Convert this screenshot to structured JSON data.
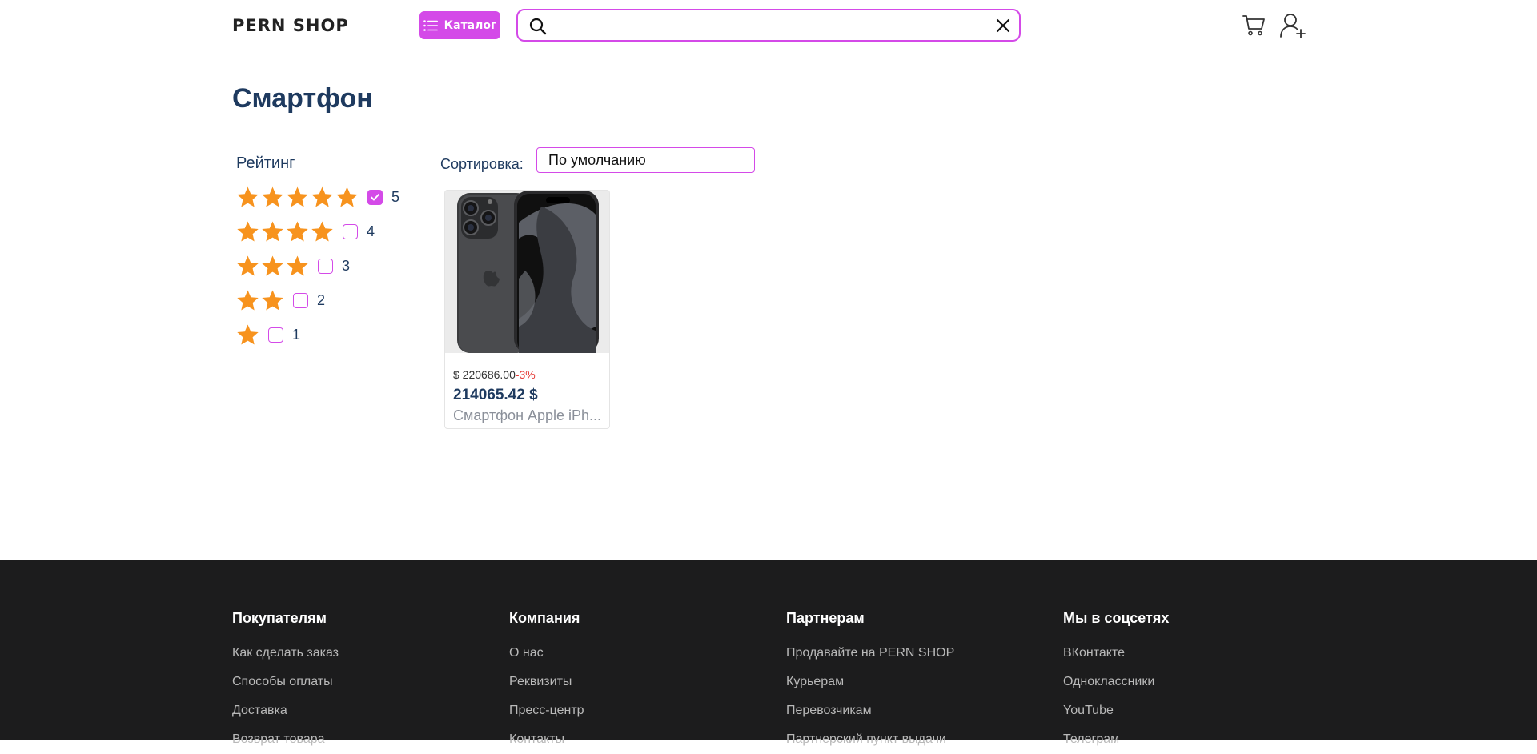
{
  "header": {
    "logo": "PERN SHOP",
    "catalog_label": "Каталог",
    "search_value": "",
    "search_placeholder": ""
  },
  "page_title": "Смартфон",
  "filters": {
    "rating_title": "Рейтинг",
    "rows": [
      {
        "stars": 5,
        "label": "5",
        "checked": true
      },
      {
        "stars": 4,
        "label": "4",
        "checked": false
      },
      {
        "stars": 3,
        "label": "3",
        "checked": false
      },
      {
        "stars": 2,
        "label": "2",
        "checked": false
      },
      {
        "stars": 1,
        "label": "1",
        "checked": false
      }
    ]
  },
  "sort": {
    "label": "Сортировка:",
    "value": "По умолчанию"
  },
  "products": [
    {
      "old_price": "$ 220686.00",
      "discount": "-3%",
      "price": "214065.42 $",
      "name": "Смартфон Apple iPh..."
    }
  ],
  "footer": {
    "columns": [
      {
        "title": "Покупателям",
        "links": [
          "Как сделать заказ",
          "Способы оплаты",
          "Доставка",
          "Возврат товара"
        ]
      },
      {
        "title": "Компания",
        "links": [
          "О нас",
          "Реквизиты",
          "Пресс-центр",
          "Контакты"
        ]
      },
      {
        "title": "Партнерам",
        "links": [
          "Продавайте на PERN SHOP",
          "Курьерам",
          "Перевозчикам",
          "Партнерский пункт выдачи"
        ]
      },
      {
        "title": "Мы в соцсетях",
        "links": [
          "ВКонтакте",
          "Одноклассники",
          "YouTube",
          "Телеграм"
        ]
      }
    ]
  },
  "colors": {
    "accent": "#d44ae8",
    "star": "#f7931e",
    "text": "#1e3a5f",
    "footer_bg": "#1c1c1d"
  }
}
